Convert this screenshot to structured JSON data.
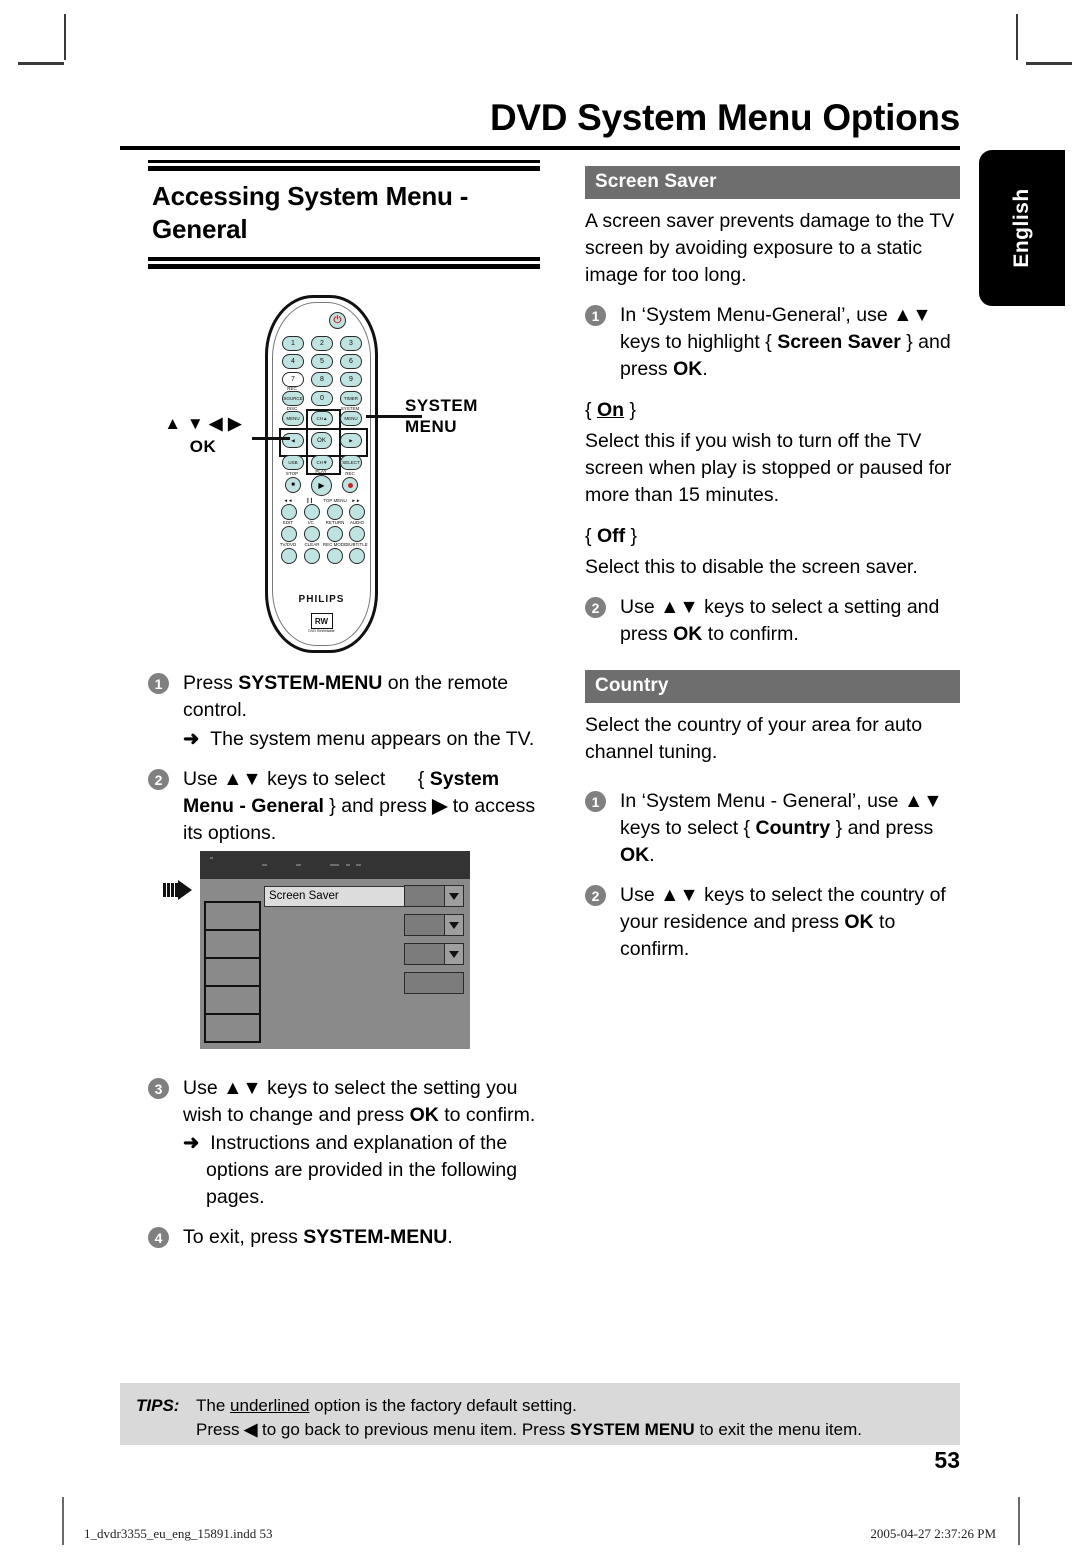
{
  "document": {
    "title": "DVD System Menu Options",
    "language_tab": "English",
    "page_number": "53"
  },
  "left_column": {
    "heading": "Accessing System Menu - General",
    "steps": [
      {
        "number": "1",
        "parts": [
          {
            "t": "Press ",
            "b": false
          },
          {
            "t": "SYSTEM-MENU",
            "b": true
          },
          {
            "t": " on the remote control.",
            "b": false
          }
        ],
        "arrow_note": "The system menu appears on the TV."
      },
      {
        "number": "2",
        "parts": [
          {
            "t": "Use ",
            "b": false
          },
          {
            "t": "▲▼",
            "b": false
          },
          {
            "t": " keys to select       { ",
            "b": false
          },
          {
            "t": "System Menu - General",
            "b": true
          },
          {
            "t": " } and press ",
            "b": false
          },
          {
            "t": "▶",
            "b": false
          },
          {
            "t": " to access its options.",
            "b": false
          }
        ]
      },
      {
        "number": "3",
        "parts": [
          {
            "t": "Use ",
            "b": false
          },
          {
            "t": "▲▼",
            "b": false
          },
          {
            "t": " keys to select the setting you wish to change and press ",
            "b": false
          },
          {
            "t": "OK",
            "b": true
          },
          {
            "t": " to confirm.",
            "b": false
          }
        ],
        "arrow_note": "Instructions and explanation of the options are provided in the following pages."
      },
      {
        "number": "4",
        "parts": [
          {
            "t": "To exit, press ",
            "b": false
          },
          {
            "t": "SYSTEM-MENU",
            "b": true
          },
          {
            "t": ".",
            "b": false
          }
        ]
      }
    ],
    "remote": {
      "brand": "PHILIPS",
      "rw_logo": "RW",
      "rw_sub": "DVD ReWritable",
      "callout_left_keys": "▲ ▼ ◀ ▶",
      "callout_left_ok": "OK",
      "callout_right_line1": "SYSTEM",
      "callout_right_line2": "MENU",
      "number_keys": [
        "1",
        "2",
        "3",
        "4",
        "5",
        "6",
        "7",
        "8",
        "9",
        "0"
      ],
      "key_labels": {
        "rec_source": "SOURCE",
        "rec_source_top": "REC",
        "timer": "TIMER",
        "disc_menu_top": "DISC",
        "disc_menu": "MENU",
        "system_menu_top": "SYSTEM",
        "system_menu": "MENU",
        "ch_up": "CH",
        "ch_down": "CH",
        "usb": "USB",
        "select": "SELECT",
        "ok": "OK",
        "stop": "STOP",
        "play": "PLAY",
        "rec": "REC",
        "row1": [
          "◀◀",
          "▮▮",
          "TOP MENU",
          "▶▶"
        ],
        "row2": [
          "EDIT",
          "I/C",
          "RETURN",
          "AUDIO"
        ],
        "row3": [
          "TV/DVD",
          "CLEAR",
          "REC MODE",
          "SUBTITLE"
        ]
      }
    },
    "tv_mockup": {
      "highlighted_row": "Screen Saver"
    }
  },
  "right_column": {
    "sections": [
      {
        "bar_title": "Screen Saver",
        "intro": "A screen saver prevents damage to the TV screen by avoiding exposure to a static image for too long.",
        "steps": [
          {
            "number": "1",
            "parts": [
              {
                "t": "In ‘System Menu-General’, use ",
                "b": false
              },
              {
                "t": "▲▼",
                "b": false
              },
              {
                "t": " keys to highlight { ",
                "b": false
              },
              {
                "t": "Screen Saver",
                "b": true
              },
              {
                "t": " } and press ",
                "b": false
              },
              {
                "t": "OK",
                "b": true
              },
              {
                "t": ".",
                "b": false
              }
            ]
          }
        ],
        "options": [
          {
            "label": "On",
            "underlined": true,
            "desc": "Select this if you wish to turn off the TV screen when play is stopped or paused for more than 15 minutes."
          },
          {
            "label": "Off",
            "underlined": false,
            "desc": "Select this to disable the screen saver."
          }
        ],
        "steps_after": [
          {
            "number": "2",
            "parts": [
              {
                "t": "Use ",
                "b": false
              },
              {
                "t": "▲▼",
                "b": false
              },
              {
                "t": " keys to select a setting and press ",
                "b": false
              },
              {
                "t": "OK",
                "b": true
              },
              {
                "t": " to confirm.",
                "b": false
              }
            ]
          }
        ]
      },
      {
        "bar_title": "Country",
        "intro": "Select the country of your area for auto channel tuning.",
        "steps": [
          {
            "number": "1",
            "parts": [
              {
                "t": "In ‘System Menu - General’, use ",
                "b": false
              },
              {
                "t": "▲▼",
                "b": false
              },
              {
                "t": " keys to select { ",
                "b": false
              },
              {
                "t": "Country",
                "b": true
              },
              {
                "t": " } and press ",
                "b": false
              },
              {
                "t": "OK",
                "b": true
              },
              {
                "t": ".",
                "b": false
              }
            ]
          },
          {
            "number": "2",
            "parts": [
              {
                "t": "Use ",
                "b": false
              },
              {
                "t": "▲▼",
                "b": false
              },
              {
                "t": " keys to select the country of your residence and press ",
                "b": false
              },
              {
                "t": "OK",
                "b": true
              },
              {
                "t": " to confirm.",
                "b": false
              }
            ]
          }
        ],
        "options": [],
        "steps_after": []
      }
    ]
  },
  "tips": {
    "label": "TIPS:",
    "line1_pre": "The ",
    "line1_underlined": "underlined",
    "line1_post": " option is the factory default setting.",
    "line2_parts": [
      {
        "t": "Press ",
        "b": false
      },
      {
        "t": "◀",
        "b": false
      },
      {
        "t": " to go back to previous menu item. Press ",
        "b": false
      },
      {
        "t": "SYSTEM MENU",
        "b": true
      },
      {
        "t": " to exit the menu item.",
        "b": false
      }
    ]
  },
  "footer": {
    "file": "1_dvdr3355_eu_eng_15891.indd   53",
    "timestamp": "2005-04-27   2:37:26 PM"
  },
  "colors": {
    "bar_gray": "#6e6e6e",
    "tips_gray": "#d9d9d9",
    "step_circle": "#808080",
    "remote_key": "#bfe3e0",
    "rec_red": "#d02020",
    "tv_bg": "#8a8a8a"
  }
}
